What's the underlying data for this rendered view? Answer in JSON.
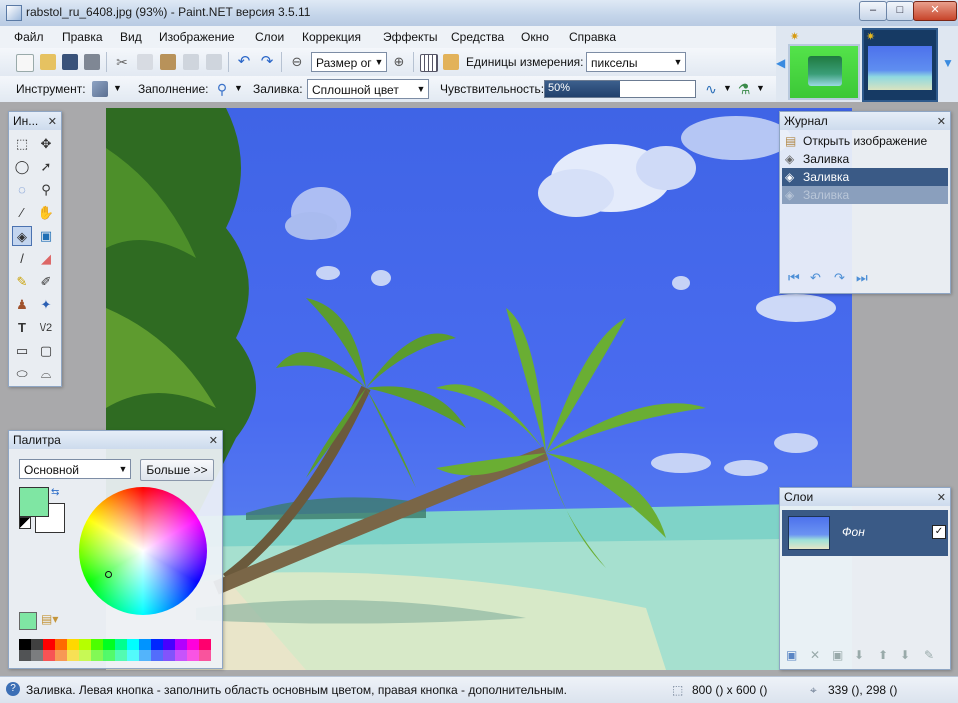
{
  "window": {
    "title": "rabstol_ru_6408.jpg (93%) - Paint.NET версия 3.5.11",
    "minimize": "–",
    "maximize": "□",
    "close": "✕"
  },
  "menu": [
    "Файл",
    "Правка",
    "Вид",
    "Изображение",
    "Слои",
    "Коррекция",
    "Эффекты",
    "Средства",
    "Окно",
    "Справка"
  ],
  "toolbar1": {
    "zoom_value": "Размер ог",
    "units_label": "Единицы измерения:",
    "units_value": "пикселы"
  },
  "toolbar2": {
    "tool_label": "Инструмент:",
    "fill_label": "Заполнение:",
    "mode_label": "Заливка:",
    "mode_value": "Сплошной цвет",
    "tolerance_label": "Чувствительность:",
    "tolerance_value": "50%",
    "tolerance_fraction": 0.5
  },
  "tools_panel": {
    "title": "Ин..."
  },
  "history_panel": {
    "title": "Журнал",
    "items": [
      "Открыть изображение",
      "Заливка",
      "Заливка",
      "Заливка"
    ]
  },
  "palette_panel": {
    "title": "Палитра",
    "mode_value": "Основной",
    "more_button": "Больше >>"
  },
  "layers_panel": {
    "title": "Слои",
    "layer_name": "Фон"
  },
  "status": {
    "message": "Заливка. Левая кнопка - заполнить область основным цветом, правая кнопка - дополнительным.",
    "image_size": "800 () x 600 ()",
    "cursor_pos": "339 (), 298 ()"
  },
  "colors": {
    "primary": "#7fe6a3",
    "secondary": "#ffffff",
    "sky": "#4468ee",
    "selection": "#3a5a86"
  },
  "palette_colors": [
    "#000000",
    "#404040",
    "#ff0000",
    "#ff6a00",
    "#ffd800",
    "#b6ff00",
    "#4cff00",
    "#00ff21",
    "#00ff90",
    "#00ffff",
    "#0094ff",
    "#0026ff",
    "#4800ff",
    "#b200ff",
    "#ff00dc",
    "#ff006e"
  ]
}
